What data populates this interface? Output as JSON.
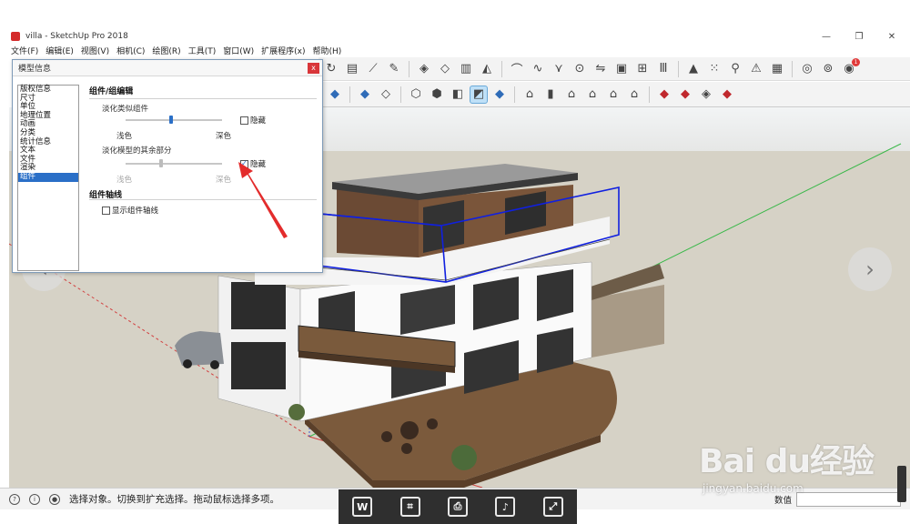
{
  "window": {
    "title": "villa - SketchUp Pro 2018",
    "minimize": "—",
    "restore": "❐",
    "close": "✕"
  },
  "menu": [
    "文件(F)",
    "编辑(E)",
    "视图(V)",
    "相机(C)",
    "绘图(R)",
    "工具(T)",
    "窗口(W)",
    "扩展程序(x)",
    "帮助(H)"
  ],
  "toolbar1_icons": [
    "rotate-icon",
    "push-pull-icon",
    "tape-icon",
    "pen-icon",
    "component-icon",
    "component2-icon",
    "scale-icon",
    "follow-icon",
    "arc-icon",
    "sandbox-icon",
    "smooth-icon",
    "stamp-icon",
    "flip-icon",
    "box-icon",
    "section-icon",
    "fence-icon",
    "tent-icon",
    "dots-icon",
    "figure-icon",
    "compass-icon",
    "trash-icon",
    "settings-icon",
    "import-icon",
    "extension-icon"
  ],
  "toolbar1_badge": "1",
  "dialog": {
    "title": "模型信息",
    "close": "x",
    "categories": [
      "版权信息",
      "尺寸",
      "单位",
      "地理位置",
      "动画",
      "分类",
      "统计信息",
      "文本",
      "文件",
      "渲染",
      "组件"
    ],
    "selected_index": 10,
    "section1_title": "组件/组编辑",
    "fade_similar_label": "淡化类似组件",
    "fade_similar_hide": "隐藏",
    "fade_similar_hide_checked": false,
    "fade_similar_level": 0.45,
    "fade_rest_label": "淡化模型的其余部分",
    "fade_rest_hide": "隐藏",
    "fade_rest_hide_checked": true,
    "fade_rest_level": 0.35,
    "light": "浅色",
    "dark": "深色",
    "section2_title": "组件轴线",
    "show_axes": "显示组件轴线",
    "show_axes_checked": false
  },
  "status": {
    "message": "选择对象。切换到扩充选择。拖动鼠标选择多项。",
    "measurement_label": "数值",
    "measurement_value": ""
  },
  "overlay_icons": [
    "edit-text-icon",
    "crop-icon",
    "print-icon",
    "audio-icon",
    "expand-icon"
  ],
  "watermark": {
    "main": "Bai du经验",
    "sub": "jingyan.baidu.com"
  },
  "colors": {
    "selection_blue": "#1020e0",
    "annotation_red": "#e32c2c",
    "dialog_select": "#2a6fc7"
  }
}
